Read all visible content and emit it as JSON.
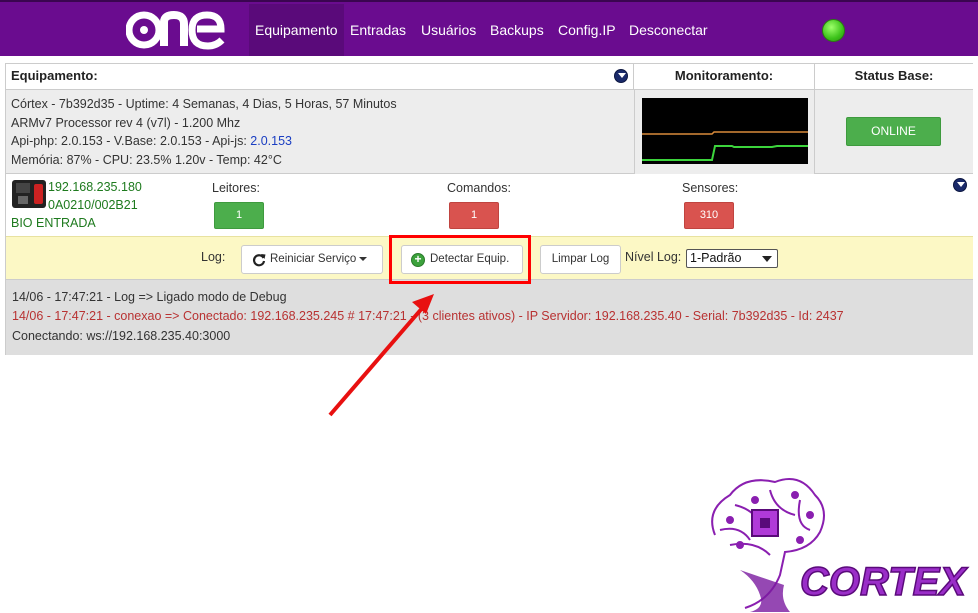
{
  "nav": {
    "logo_text": "one",
    "items": [
      {
        "label": "Equipamento",
        "active": true
      },
      {
        "label": "Entradas"
      },
      {
        "label": "Usuários"
      },
      {
        "label": "Backups"
      },
      {
        "label": "Config.IP"
      },
      {
        "label": "Desconectar"
      }
    ],
    "status_color": "#3cc21a"
  },
  "headers": {
    "equipamento": "Equipamento:",
    "monitoramento": "Monitoramento:",
    "status_base": "Status Base:"
  },
  "info": {
    "line1": "Córtex - 7b392d35 - Uptime: 4 Semanas, 4 Dias, 5 Horas, 57 Minutos",
    "line2": "ARMv7 Processor rev 4 (v7l) - 1.200 Mhz",
    "line3_prefix": "Api-php: 2.0.153 - V.Base: 2.0.153 - Api-js: ",
    "line3_apijs": "2.0.153",
    "line4": "Memória: 87% - CPU: 23.5% 1.20v - Temp: 42°C"
  },
  "status_base": {
    "label": "ONLINE",
    "color": "#4cae4c"
  },
  "device": {
    "ip": "192.168.235.180",
    "id": "0A0210/002B21",
    "name": "BIO ENTRADA"
  },
  "counters": {
    "leitores": {
      "label": "Leitores:",
      "value": "1"
    },
    "comandos": {
      "label": "Comandos:",
      "value": "1"
    },
    "sensores": {
      "label": "Sensores:",
      "value": "310"
    }
  },
  "log_bar": {
    "label": "Log:",
    "restart": "Reiniciar Serviço",
    "detect": "Detectar Equip.",
    "clear": "Limpar Log",
    "nivel_label": "Nível Log:",
    "nivel_value": "1-Padrão"
  },
  "log_lines": [
    "14/06 - 17:47:21 - Log => Ligado modo de Debug",
    "14/06 - 17:47:21 - conexao => Conectado: 192.168.235.245 # 17:47:21 - (3 clientes ativos) - IP Servidor: 192.168.235.40 - Serial: 7b392d35 - Id: 2437",
    "Conectando: ws://192.168.235.40:3000"
  ],
  "watermark": "CORTEX"
}
